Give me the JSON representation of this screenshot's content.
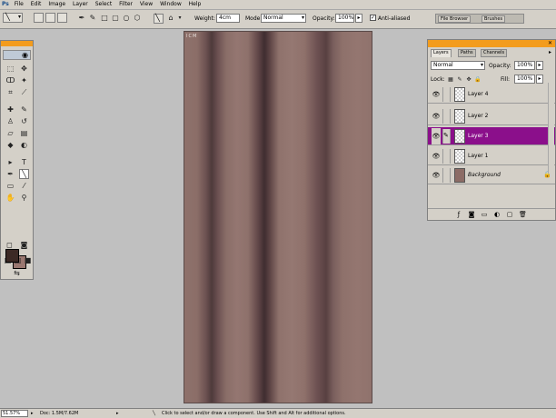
{
  "menu": {
    "app_icon": "Ps",
    "items": [
      "File",
      "Edit",
      "Image",
      "Layer",
      "Select",
      "Filter",
      "View",
      "Window",
      "Help"
    ]
  },
  "options": {
    "weight_label": "Weight:",
    "weight_value": "4cm",
    "mode_label": "Mode:",
    "mode_value": "Normal",
    "opacity_label": "Opacity:",
    "opacity_value": "100%",
    "antialiased_label": "Anti-aliased",
    "well_tabs": [
      "File Browser",
      "Brushes"
    ]
  },
  "canvas": {
    "tag": "ICM"
  },
  "layers_palette": {
    "tabs": [
      "Layers",
      "Paths",
      "Channels"
    ],
    "blend_mode": "Normal",
    "opacity_label": "Opacity:",
    "opacity_value": "100%",
    "lock_label": "Lock:",
    "fill_label": "Fill:",
    "fill_value": "100%",
    "layers": [
      {
        "name": "Layer 4",
        "selected": false
      },
      {
        "name": "Layer 2",
        "selected": false
      },
      {
        "name": "Layer 3",
        "selected": true
      },
      {
        "name": "Layer 1",
        "selected": false
      },
      {
        "name": "Background",
        "selected": false
      }
    ]
  },
  "status": {
    "zoom": "51.57%",
    "doc": "Doc: 1.5M/7.62M",
    "hint": "Click to select and/or draw a component. Use Shift and Alt for additional options."
  },
  "colors": {
    "foreground": "#3c2925",
    "background": "#9a7770",
    "selected_layer": "#8b0f8b",
    "palette_title": "#f39c1d"
  }
}
